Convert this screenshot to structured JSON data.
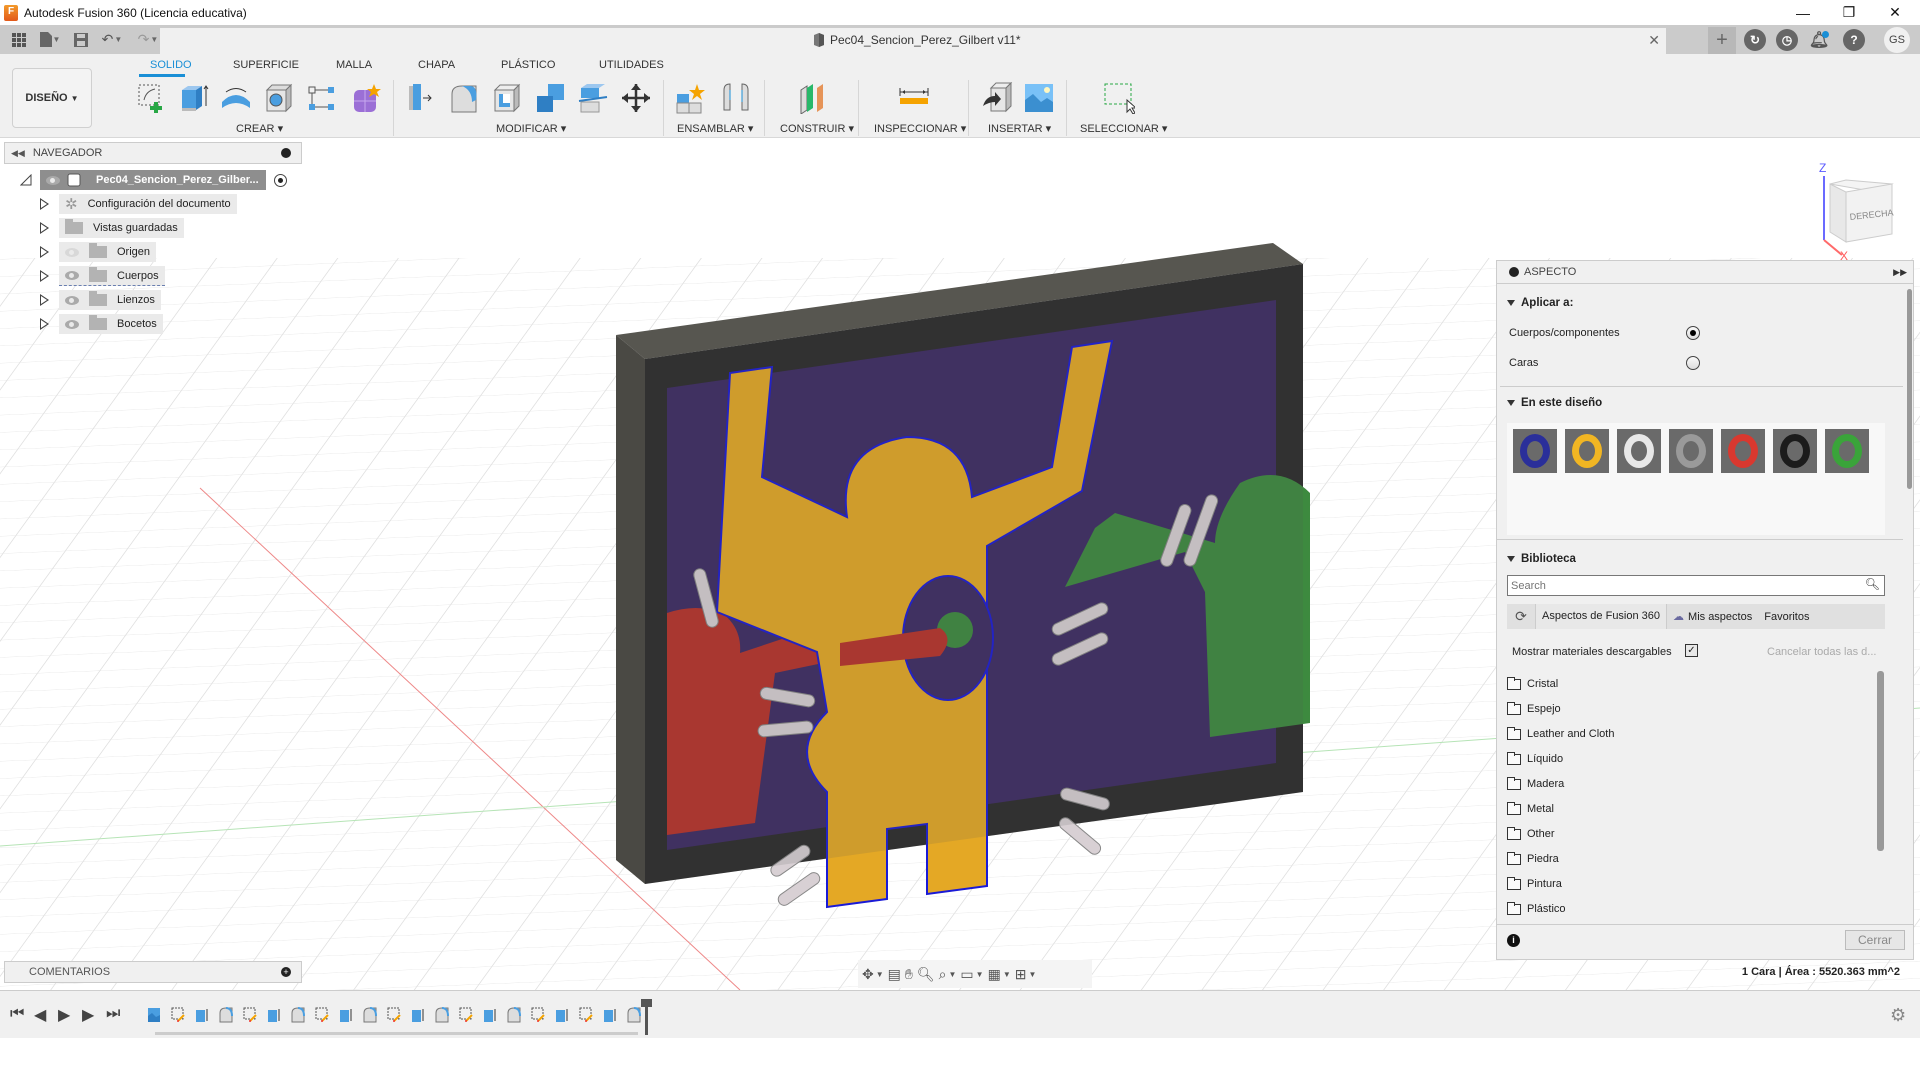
{
  "app": {
    "title": "Autodesk Fusion 360 (Licencia educativa)",
    "logo_letter": "F"
  },
  "window_controls": {
    "minimize": "—",
    "restore": "❐",
    "close": "✕"
  },
  "tab": {
    "document_name": "Pec04_Sencion_Perez_Gilbert v11*",
    "close": "✕",
    "new_tab": "+"
  },
  "user": {
    "initials": "GS"
  },
  "toolbar": {
    "workspace": "DISEÑO",
    "tabs": [
      "SOLIDO",
      "SUPERFICIE",
      "MALLA",
      "CHAPA",
      "PLÁSTICO",
      "UTILIDADES"
    ],
    "active_tab": "SOLIDO",
    "groups": {
      "crear": "CREAR",
      "modificar": "MODIFICAR",
      "ensamblar": "ENSAMBLAR",
      "construir": "CONSTRUIR",
      "inspeccionar": "INSPECCIONAR",
      "insertar": "INSERTAR",
      "seleccionar": "SELECCIONAR"
    }
  },
  "navigator": {
    "title": "NAVEGADOR",
    "root": "Pec04_Sencion_Perez_Gilber...",
    "items": [
      {
        "label": "Configuración del documento",
        "icon": "gear-icon",
        "visible": null
      },
      {
        "label": "Vistas guardadas",
        "icon": "folder-icon",
        "visible": null
      },
      {
        "label": "Origen",
        "icon": "folder-icon",
        "visible": false
      },
      {
        "label": "Cuerpos",
        "icon": "folder-icon",
        "visible": true
      },
      {
        "label": "Lienzos",
        "icon": "folder-icon",
        "visible": true
      },
      {
        "label": "Bocetos",
        "icon": "folder-icon",
        "visible": true
      }
    ]
  },
  "viewcube": {
    "face": "DERECHA",
    "axis_z": "Z",
    "axis_x": "X"
  },
  "aspecto": {
    "title": "ASPECTO",
    "apply_to": {
      "title": "Aplicar a:",
      "options": [
        {
          "label": "Cuerpos/componentes",
          "selected": true
        },
        {
          "label": "Caras",
          "selected": false
        }
      ]
    },
    "in_design": {
      "title": "En este diseño",
      "swatches": [
        {
          "name": "blue",
          "color": "#2a2f9a"
        },
        {
          "name": "yellow",
          "color": "#f1b623"
        },
        {
          "name": "white",
          "color": "#e8e8e8"
        },
        {
          "name": "chrome",
          "color": "#9a9a9a"
        },
        {
          "name": "red",
          "color": "#d9382f"
        },
        {
          "name": "black",
          "color": "#1b1b1b"
        },
        {
          "name": "green",
          "color": "#3aa43a"
        }
      ]
    },
    "library": {
      "title": "Biblioteca",
      "search_placeholder": "Search",
      "tabs": [
        "Aspectos de Fusion 360",
        "Mis aspectos",
        "Favoritos"
      ],
      "show_downloadable": "Mostrar materiales descargables",
      "show_downloadable_checked": true,
      "cancel_all": "Cancelar todas las d...",
      "folders": [
        "Cristal",
        "Espejo",
        "Leather and Cloth",
        "Líquido",
        "Madera",
        "Metal",
        "Other",
        "Piedra",
        "Pintura",
        "Plástico"
      ]
    },
    "close_button": "Cerrar"
  },
  "comments": {
    "title": "COMENTARIOS"
  },
  "status": {
    "selection": "1 Cara | Área : 5520.363 mm^2"
  },
  "model_colors": {
    "frame": "#2b2b2b",
    "background_panel": "#3d2b63",
    "yellow_figure": "#e4a825",
    "red_figure": "#b8322a",
    "green_figure": "#3d8a3f",
    "motion_lines": "#d8d0d4",
    "selection_edge": "#1a1ad6"
  },
  "timeline": {
    "features": [
      "canvas",
      "sketch",
      "extrude",
      "fillet",
      "sketch",
      "extrude",
      "fillet",
      "sketch",
      "extrude",
      "fillet",
      "sketch",
      "extrude",
      "fillet",
      "sketch",
      "extrude",
      "fillet",
      "sketch",
      "extrude",
      "sketch",
      "extrude",
      "fillet"
    ]
  }
}
